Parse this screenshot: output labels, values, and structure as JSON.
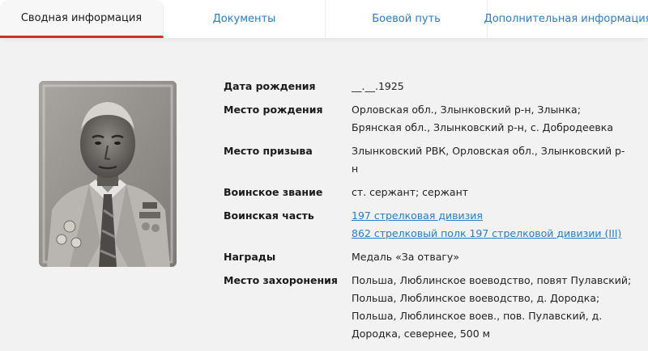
{
  "tabs": [
    {
      "label": "Сводная информация",
      "active": true
    },
    {
      "label": "Документы",
      "active": false
    },
    {
      "label": "Боевой путь",
      "active": false
    },
    {
      "label": "Дополнительная информация",
      "active": false
    }
  ],
  "fields": {
    "birth_date": {
      "label": "Дата рождения",
      "lines": [
        "__.__.1925"
      ]
    },
    "birth_place": {
      "label": "Место рождения",
      "lines": [
        "Орловская обл., Злынковский р-н, Злынка;",
        "Брянская обл., Злынковский р-н, с. Добродеевка"
      ]
    },
    "draft_place": {
      "label": "Место призыва",
      "lines": [
        "Злынковский РВК, Орловская обл., Злынковский р-",
        "н"
      ]
    },
    "rank": {
      "label": "Воинское звание",
      "lines": [
        "ст. сержант; сержант"
      ]
    },
    "unit": {
      "label": "Воинская часть",
      "links": [
        "197 стрелковая дивизия",
        "862 стрелковый полк 197 стрелковой дивизии (III)"
      ]
    },
    "awards": {
      "label": "Награды",
      "lines": [
        "Медаль «За отвагу»"
      ]
    },
    "burial": {
      "label": "Место захоронения",
      "lines": [
        "Польша, Люблинское воеводство, повят Пулавский;",
        "Польша, Люблинское воеводство, д. Дородка;",
        "Польша, Люблинское воев., пов. Пулавский, д.",
        "Дородка, севернее, 500 м"
      ]
    }
  },
  "colors": {
    "accent": "#d32f2f",
    "link": "#2a7ccc"
  }
}
